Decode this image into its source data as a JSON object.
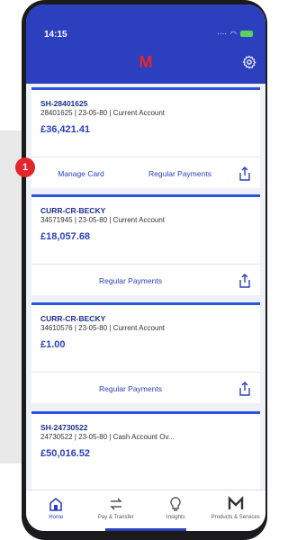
{
  "status": {
    "time": "14:15"
  },
  "header": {
    "logo": "M"
  },
  "badge": {
    "number": "1"
  },
  "accounts": [
    {
      "name": "SH-28401625",
      "meta": "28401625 | 23-05-80 | Current Account",
      "balance": "£36,421.41",
      "actions": [
        "Manage Card",
        "Regular Payments"
      ]
    },
    {
      "name": "CURR-CR-BECKY",
      "meta": "34571945 | 23-05-80 | Current Account",
      "balance": "£18,057.68",
      "actions": [
        "Regular Payments"
      ]
    },
    {
      "name": "CURR-CR-BECKY",
      "meta": "34610576 | 23-05-80 | Current Account",
      "balance": "£1.00",
      "actions": [
        "Regular Payments"
      ]
    },
    {
      "name": "SH-24730522",
      "meta": "24730522 | 23-05-80 | Cash Account Ov...",
      "balance": "£50,016.52",
      "actions": []
    }
  ],
  "nav": [
    {
      "label": "Home",
      "icon": "home-icon",
      "active": true
    },
    {
      "label": "Pay & Transfer",
      "icon": "transfer-icon"
    },
    {
      "label": "Insights",
      "icon": "bulb-icon"
    },
    {
      "label": "Products & Services",
      "icon": "m-icon"
    }
  ]
}
